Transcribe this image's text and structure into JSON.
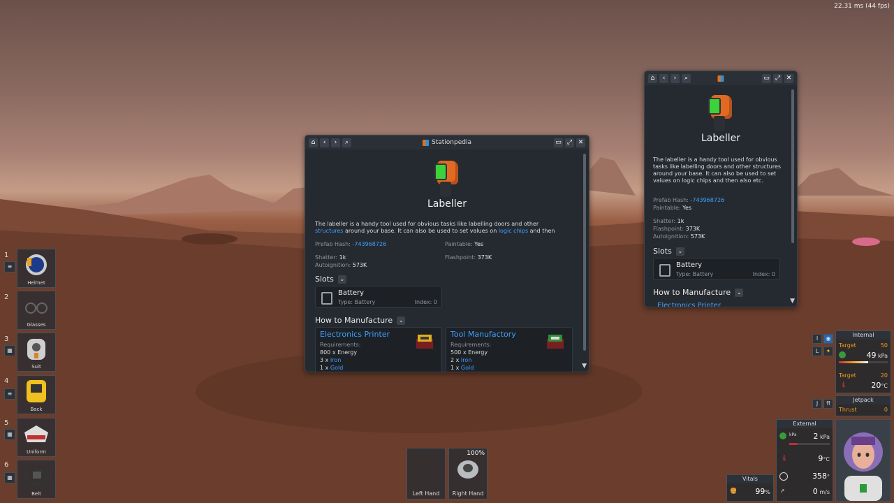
{
  "fps": "22.31 ms (44 fps)",
  "main_window": {
    "title": "Stationpedia",
    "item_name": "Labeller",
    "desc_a": "The labeller is a handy tool used for obvious tasks like labelling doors and other",
    "desc_link1": "structures",
    "desc_b": " around your base. It can also be used to set values on ",
    "desc_link2": "logic chips",
    "desc_c": " and then",
    "prefab_label": "Prefab Hash:",
    "prefab_value": "-743968726",
    "paintable_label": "Paintable:",
    "paintable_value": "Yes",
    "shatter_label": "Shatter:",
    "shatter_value": "1k",
    "flashpoint_label": "Flashpoint:",
    "flashpoint_value": "373K",
    "autoignition_label": "Autoignition:",
    "autoignition_value": "573K",
    "slots_heading": "Slots",
    "slot_name": "Battery",
    "slot_type": "Type: Battery",
    "slot_index": "Index: 0",
    "manufacture_heading": "How to Manufacture",
    "recipes": [
      {
        "name": "Electronics Printer",
        "req": "Requirements:",
        "l1": "800 x Energy",
        "l2a": "3 x ",
        "l2b": "Iron",
        "l3a": "1 x ",
        "l3b": "Gold"
      },
      {
        "name": "Tool Manufactory",
        "req": "Requirements:",
        "l1": "500 x Energy",
        "l2a": "2 x ",
        "l2b": "Iron",
        "l3a": "1 x ",
        "l3b": "Gold"
      }
    ]
  },
  "side_window": {
    "item_name": "Labeller",
    "desc": "The labeller is a handy tool used for obvious tasks like labelling doors and other structures around your base. It can also be used to set values on logic chips and then also etc.",
    "prefab_label": "Prefab Hash:",
    "prefab_value": "-743968726",
    "paintable_label": "Paintable:",
    "paintable_value": "Yes",
    "shatter_label": "Shatter:",
    "shatter_value": "1k",
    "flashpoint_label": "Flashpoint:",
    "flashpoint_value": "373K",
    "autoignition_label": "Autoignition:",
    "autoignition_value": "573K",
    "slots_heading": "Slots",
    "slot_name": "Battery",
    "slot_type": "Type: Battery",
    "slot_index": "Index: 0",
    "manufacture_heading": "How to Manufacture",
    "peek": "Electronics Printer"
  },
  "inventory": [
    {
      "num": "1",
      "label": "Helmet"
    },
    {
      "num": "2",
      "label": "Glasses"
    },
    {
      "num": "3",
      "label": "Suit"
    },
    {
      "num": "4",
      "label": "Back"
    },
    {
      "num": "5",
      "label": "Uniform"
    },
    {
      "num": "6",
      "label": "Belt"
    }
  ],
  "hands": {
    "left": "Left Hand",
    "right": "Right Hand",
    "right_pct": "100%"
  },
  "internal": {
    "title": "Internal",
    "target_label": "Target",
    "target_p": "50",
    "pressure": "49",
    "p_unit": "kPa",
    "target_t": "20",
    "temp": "20",
    "t_unit": "°C",
    "key_i": "I",
    "key_l": "L"
  },
  "jetpack": {
    "title": "Jetpack",
    "thrust_label": "Thrust",
    "thrust": "0",
    "key": "J"
  },
  "external": {
    "title": "External",
    "pressure": "2",
    "p_unit": "kPa",
    "temp": "9",
    "t_unit": "°C",
    "heading": "358",
    "deg": "°",
    "speed": "0",
    "s_unit": "m/s",
    "kpa_small": "kPa"
  },
  "vitals": {
    "title": "Vitals",
    "food": "99",
    "pct": "%"
  }
}
